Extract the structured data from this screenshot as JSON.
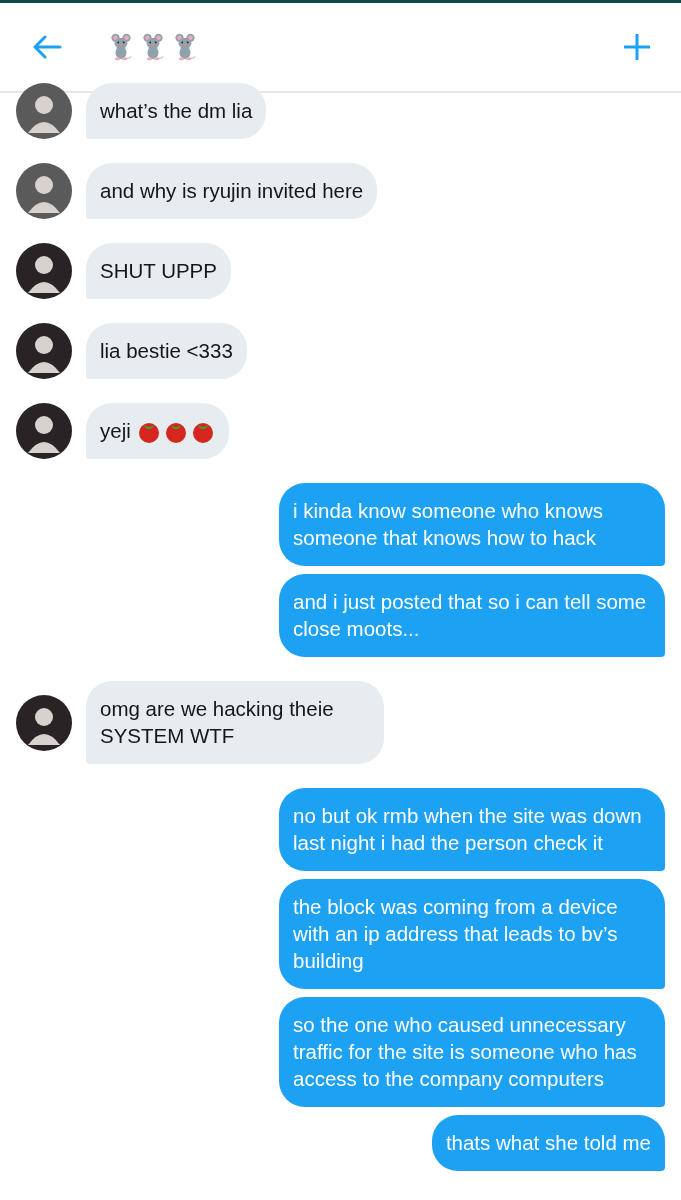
{
  "messages": [
    {
      "kind": "received",
      "color": "#5a5a5a",
      "text": "what’s the dm lia"
    },
    {
      "kind": "received",
      "color": "#5a5a5a",
      "text": "and why is ryujin invited here"
    },
    {
      "kind": "received",
      "color": "#2a2325",
      "text": "SHUT UPPP"
    },
    {
      "kind": "received",
      "color": "#2a2325",
      "text": "lia bestie <333"
    },
    {
      "kind": "tomatoes",
      "color": "#2a2325",
      "text": "yeji"
    },
    {
      "kind": "sent",
      "text": "i kinda know someone who knows someone that knows how to hack"
    },
    {
      "kind": "sent",
      "text": "and i just posted that so i can tell some close moots..."
    },
    {
      "kind": "received",
      "color": "#2a2325",
      "text": "omg are we hacking theie SYSTEM WTF"
    },
    {
      "kind": "sent",
      "text": "no but ok rmb when the site was down last night i had the person check it"
    },
    {
      "kind": "sent",
      "text": "the block was coming from a device with an ip address that leads to bv’s building"
    },
    {
      "kind": "sent",
      "text": "so the one who caused unnecessary traffic for the site is someone who has access to the company computers"
    },
    {
      "kind": "sent",
      "text": "thats what she told me"
    }
  ]
}
